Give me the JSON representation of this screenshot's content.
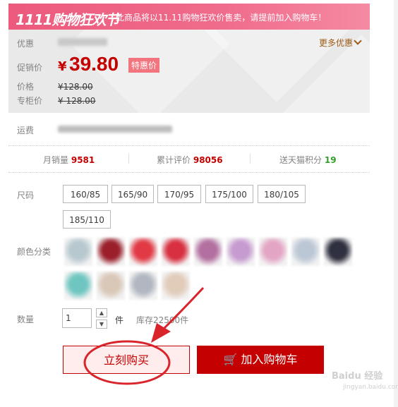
{
  "banner": {
    "logo": "1111购物狂欢节",
    "notice": "此商品将以11.11购物狂欢价售卖，请提前加入购物车！"
  },
  "promo": {
    "discount_label": "优惠",
    "more_label": "更多优惠",
    "promo_label": "促销价",
    "currency": "¥",
    "promo_price": "39.80",
    "badge": "特惠价",
    "price_label": "价格",
    "price_value": "¥128.00",
    "counter_label": "专柜价",
    "counter_value": "¥ 128.00"
  },
  "shipping": {
    "label": "运费"
  },
  "stats": {
    "monthly_label": "月销量",
    "monthly_value": "9581",
    "reviews_label": "累计评价",
    "reviews_value": "98056",
    "points_label": "送天猫积分",
    "points_value": "19"
  },
  "size": {
    "label": "尺码",
    "options": [
      "160/85",
      "165/90",
      "170/95",
      "175/100",
      "180/105",
      "185/110"
    ]
  },
  "color": {
    "label": "颜色分类",
    "swatch_colors": [
      "#b7c9cf",
      "#9b1f2b",
      "#e23a45",
      "#d83040",
      "#b36fa0",
      "#c69bd0",
      "#e3a5c4",
      "#bcc7d6",
      "#2f3040",
      "#6fc6c0",
      "#d9c7b7",
      "#b1b6c0",
      "#e1cbb9"
    ]
  },
  "quantity": {
    "label": "数量",
    "value": "1",
    "unit": "件",
    "stock": "库存22500件"
  },
  "actions": {
    "buy_now": "立刻购买",
    "add_to_cart": "加入购物车"
  },
  "accent_color": "#c40000",
  "watermark": "Baidu 经验 jingyan.baidu.com"
}
